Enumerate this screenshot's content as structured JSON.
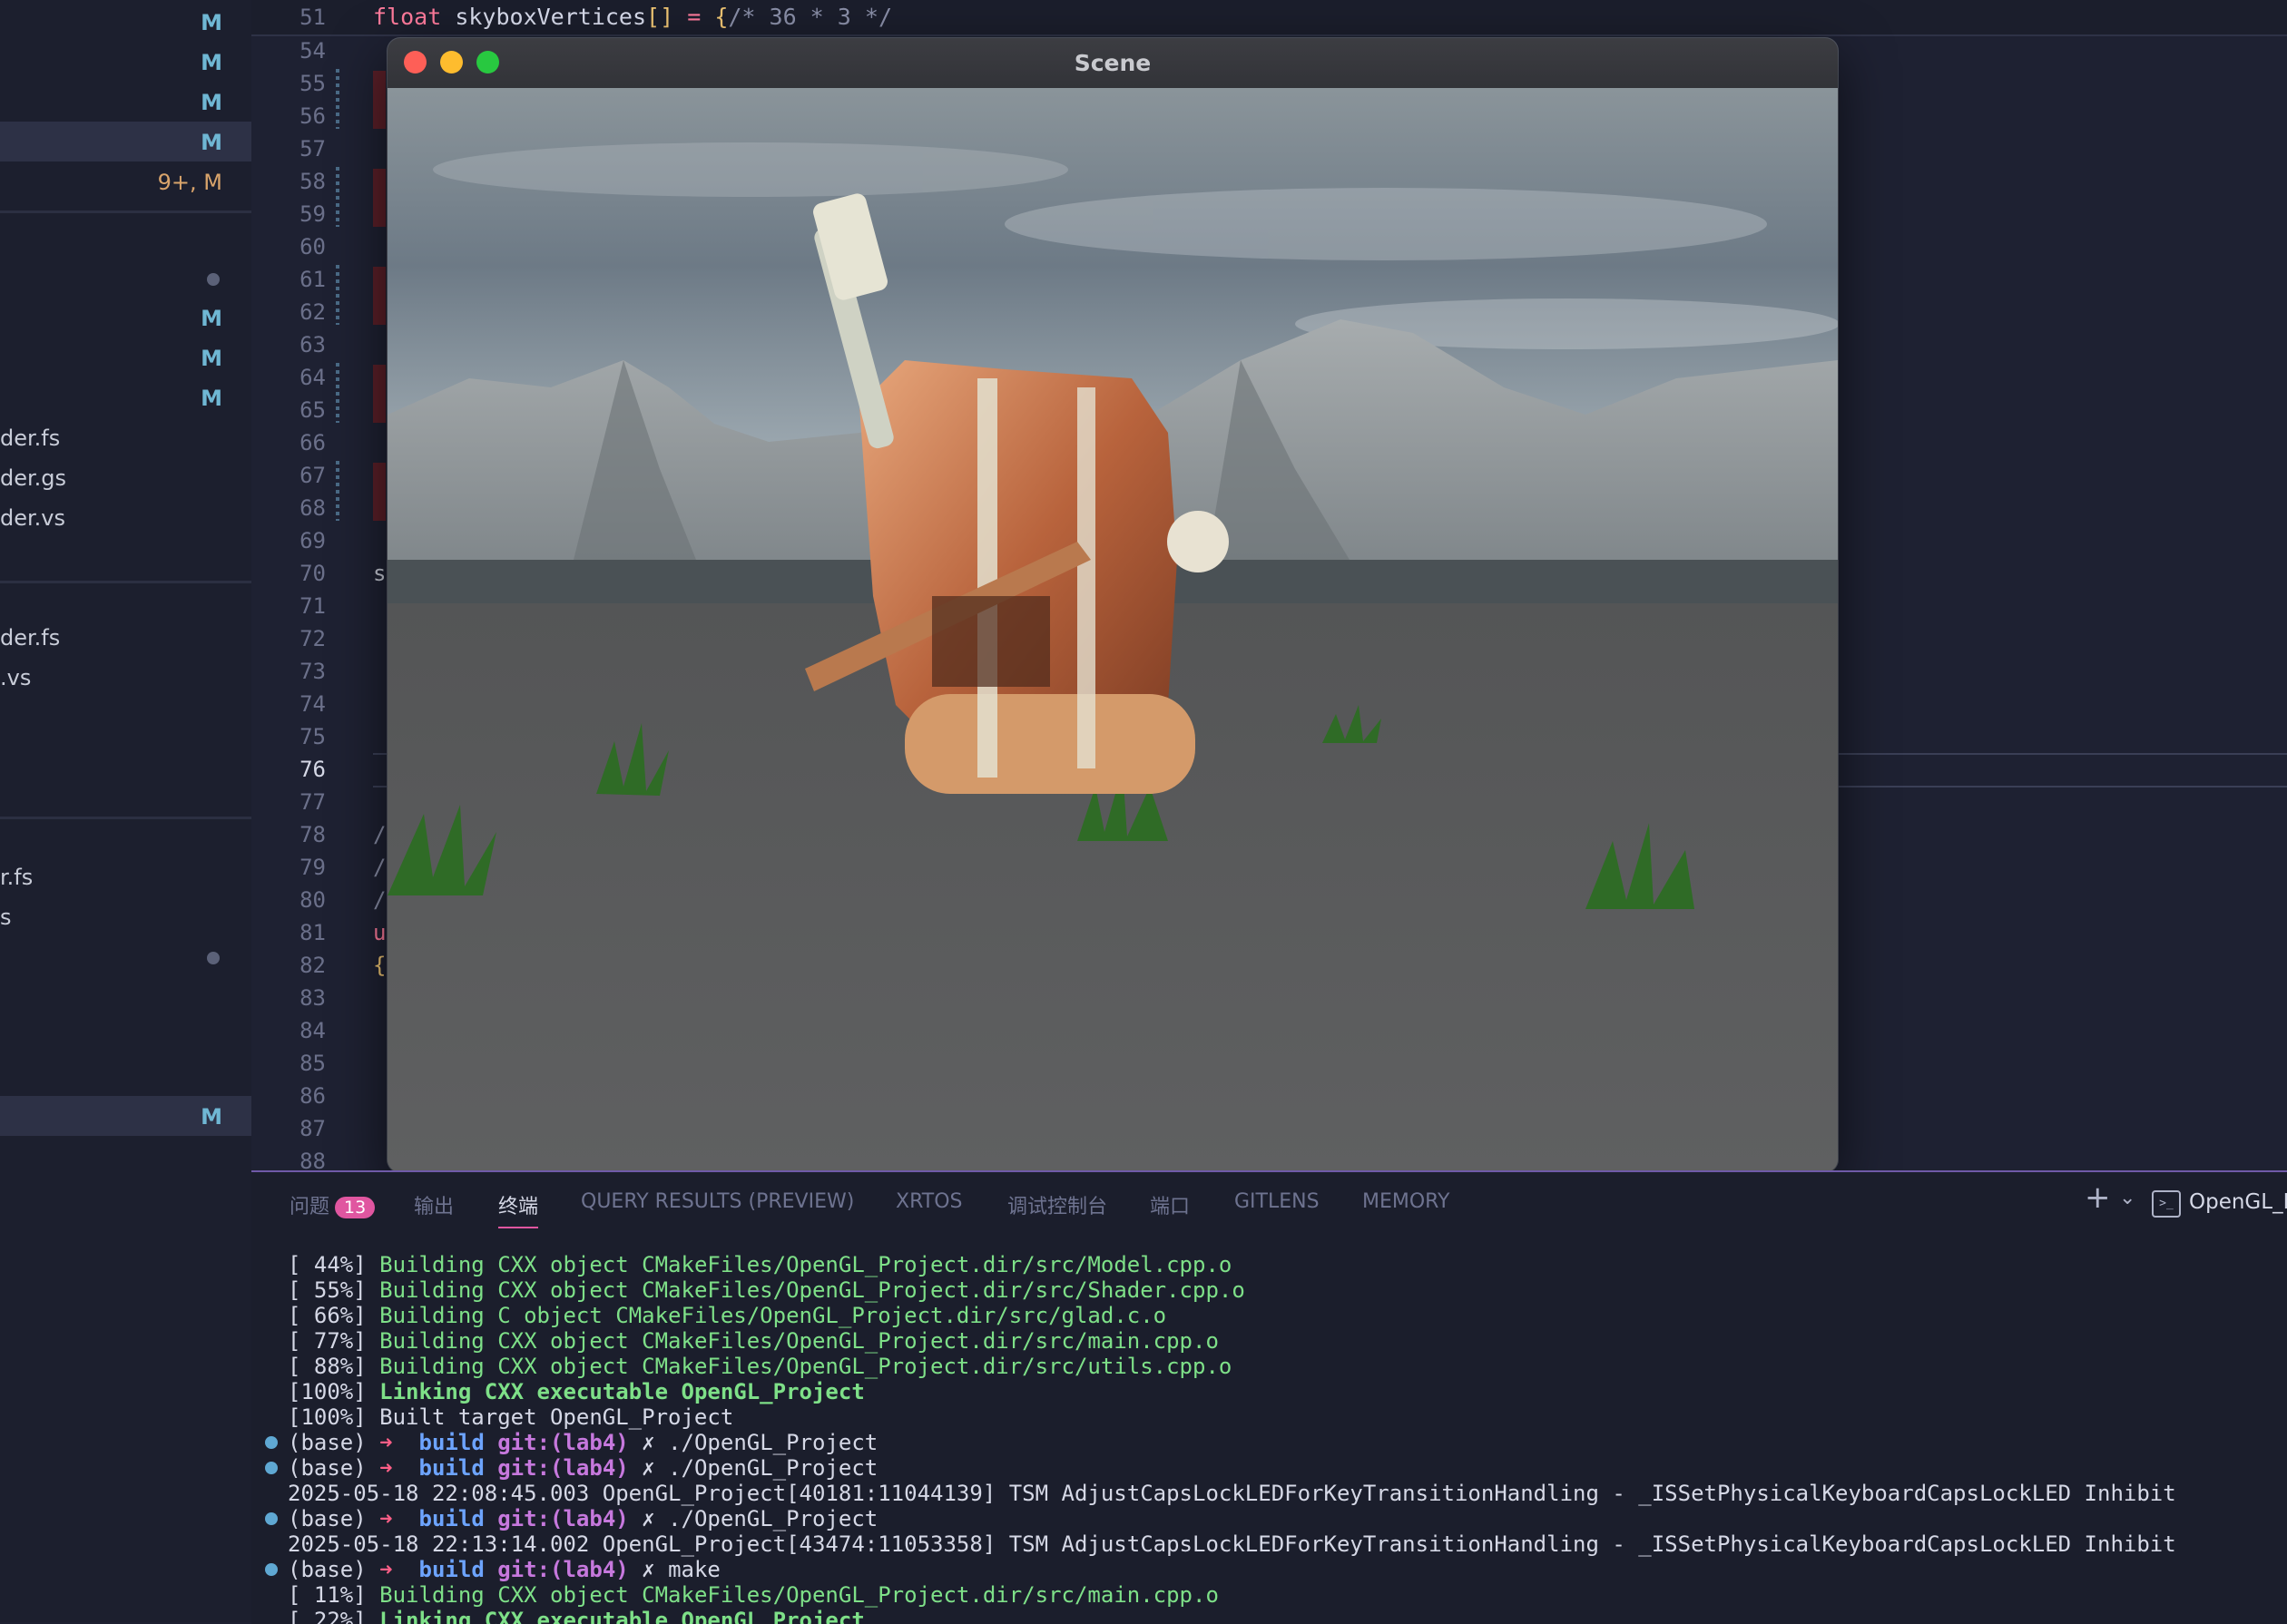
{
  "sidebar": {
    "rows": [
      {
        "name": "",
        "badge": "M"
      },
      {
        "name": "",
        "badge": "M"
      },
      {
        "name": "",
        "badge": "M"
      },
      {
        "name": "",
        "badge": "M",
        "selected": true
      },
      {
        "name": "",
        "badge": "9+, M"
      },
      {
        "name": "",
        "dot": true
      },
      {
        "name": "",
        "badge": "M"
      },
      {
        "name": "",
        "badge": "M"
      },
      {
        "name": "",
        "badge": "M"
      },
      {
        "name": "der.fs"
      },
      {
        "name": "der.gs"
      },
      {
        "name": "der.vs"
      },
      {
        "name": "der.fs"
      },
      {
        "name": ".vs"
      },
      {
        "name": "r.fs"
      },
      {
        "name": "s"
      },
      {
        "name": "",
        "dot": true
      },
      {
        "name": "",
        "badge": "M",
        "selected": true
      }
    ]
  },
  "editor": {
    "sticky": {
      "line_number": "51",
      "kw": "float",
      "ident": " skyboxVertices",
      "bracket": "[]",
      "eq": " = ",
      "brace": "{",
      "comment": "/* 36 * 3 */"
    },
    "line_numbers": [
      "54",
      "55",
      "56",
      "57",
      "58",
      "59",
      "60",
      "61",
      "62",
      "63",
      "64",
      "65",
      "66",
      "67",
      "68",
      "69",
      "70",
      "71",
      "72",
      "73",
      "74",
      "75",
      "76",
      "77",
      "78",
      "79",
      "80",
      "81",
      "82",
      "83",
      "84",
      "85",
      "86",
      "87",
      "88"
    ],
    "current_line": "76",
    "fragments": [
      {
        "line": "70",
        "text": "s",
        "color": "#c8ccd8"
      },
      {
        "line": "78",
        "text": "/",
        "color": "#8a8fa8"
      },
      {
        "line": "79",
        "text": "/",
        "color": "#8a8fa8"
      },
      {
        "line": "80",
        "text": "/",
        "color": "#8a8fa8"
      },
      {
        "line": "81",
        "text": "u",
        "color": "#ff7b9c"
      },
      {
        "line": "82",
        "text": "{",
        "color": "#f0c674"
      }
    ]
  },
  "scene": {
    "title": "Scene",
    "colors": {
      "close": "#fe5f57",
      "minimize": "#febc2e",
      "zoom": "#28c840"
    }
  },
  "panel": {
    "tabs": [
      {
        "label": "问题",
        "count": "13"
      },
      {
        "label": "输出"
      },
      {
        "label": "终端",
        "active": true
      },
      {
        "label": "QUERY RESULTS (PREVIEW)"
      },
      {
        "label": "XRTOS"
      },
      {
        "label": "调试控制台"
      },
      {
        "label": "端口"
      },
      {
        "label": "GITLENS"
      },
      {
        "label": "MEMORY"
      }
    ],
    "terminal_name": "OpenGL_P",
    "add_symbol": "+",
    "chevron": "⌄",
    "terminal_glyph": ">_"
  },
  "terminal": {
    "lines": [
      {
        "kind": "build",
        "pct": "[ 44%]",
        "text": "Building CXX object CMakeFiles/OpenGL_Project.dir/src/Model.cpp.o"
      },
      {
        "kind": "build",
        "pct": "[ 55%]",
        "text": "Building CXX object CMakeFiles/OpenGL_Project.dir/src/Shader.cpp.o"
      },
      {
        "kind": "build",
        "pct": "[ 66%]",
        "text": "Building C object CMakeFiles/OpenGL_Project.dir/src/glad.c.o"
      },
      {
        "kind": "build",
        "pct": "[ 77%]",
        "text": "Building CXX object CMakeFiles/OpenGL_Project.dir/src/main.cpp.o"
      },
      {
        "kind": "build",
        "pct": "[ 88%]",
        "text": "Building CXX object CMakeFiles/OpenGL_Project.dir/src/utils.cpp.o"
      },
      {
        "kind": "link",
        "pct": "[100%]",
        "text": "Linking CXX executable OpenGL_Project"
      },
      {
        "kind": "plain",
        "pct": "[100%]",
        "text": "Built target OpenGL_Project"
      },
      {
        "kind": "prompt",
        "env": "(base)",
        "arrow": "➜",
        "dir": "build",
        "git": "git:(lab4)",
        "x": "✗",
        "cmd": "./OpenGL_Project"
      },
      {
        "kind": "prompt",
        "env": "(base)",
        "arrow": "➜",
        "dir": "build",
        "git": "git:(lab4)",
        "x": "✗",
        "cmd": "./OpenGL_Project"
      },
      {
        "kind": "log",
        "text": "2025-05-18 22:08:45.003 OpenGL_Project[40181:11044139] TSM AdjustCapsLockLEDForKeyTransitionHandling - _ISSetPhysicalKeyboardCapsLockLED Inhibit"
      },
      {
        "kind": "prompt",
        "env": "(base)",
        "arrow": "➜",
        "dir": "build",
        "git": "git:(lab4)",
        "x": "✗",
        "cmd": "./OpenGL_Project"
      },
      {
        "kind": "log",
        "text": "2025-05-18 22:13:14.002 OpenGL_Project[43474:11053358] TSM AdjustCapsLockLEDForKeyTransitionHandling - _ISSetPhysicalKeyboardCapsLockLED Inhibit"
      },
      {
        "kind": "prompt",
        "env": "(base)",
        "arrow": "➜",
        "dir": "build",
        "git": "git:(lab4)",
        "x": "✗",
        "cmd": "make"
      },
      {
        "kind": "build",
        "pct": "[ 11%]",
        "text": "Building CXX object CMakeFiles/OpenGL_Project.dir/src/main.cpp.o"
      },
      {
        "kind": "link",
        "pct": "[ 22%]",
        "text": "Linking CXX executable OpenGL_Project"
      }
    ]
  }
}
